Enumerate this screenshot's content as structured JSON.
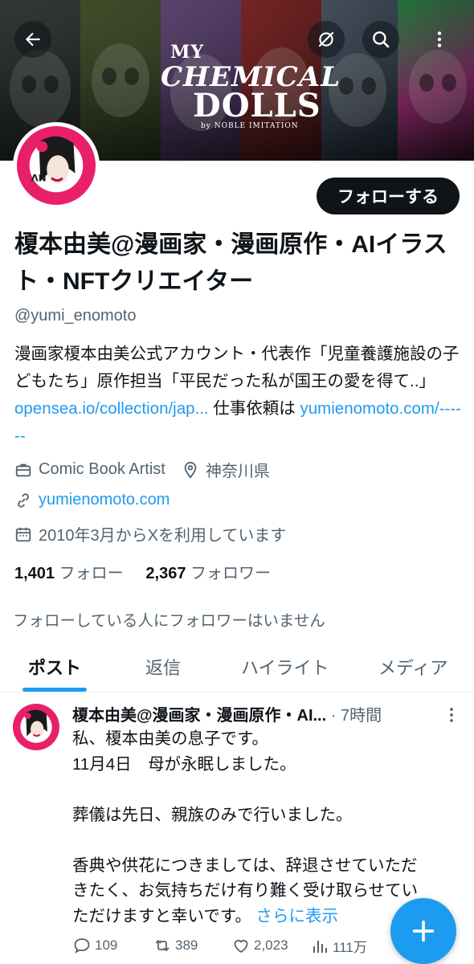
{
  "banner": {
    "logo_my": "MY",
    "logo_chemical": "CHEMICAL",
    "logo_dolls": "DOLLS",
    "logo_subtitle": "by NOBLE IMITATION",
    "colors": [
      "#2f3a36",
      "#3b4a2a",
      "#5a3b6a",
      "#7a2a2a",
      "#3a4a5a",
      "#2a6a3a"
    ]
  },
  "header": {
    "back_icon": "arrow-left-icon",
    "mute_icon": "bell-slash-icon",
    "search_icon": "search-icon",
    "more_icon": "more-vertical-icon"
  },
  "profile": {
    "follow_button": "フォローする",
    "name": "榎本由美@漫画家・漫画原作・AIイラスト・NFTクリエイター",
    "handle": "@yumi_enomoto",
    "bio_text": "漫画家榎本由美公式アカウント・代表作「児童養護施設の子どもたち」原作担当「平民だった私が国王の愛を得て..」",
    "bio_link1": "opensea.io/collection/jap...",
    "bio_mid": " 仕事依頼は ",
    "bio_link2": "yumienomoto.com/------",
    "category": "Comic Book Artist",
    "location": "神奈川県",
    "website": "yumienomoto.com",
    "joined": "2010年3月からXを利用しています",
    "following_count": "1,401",
    "following_label": "フォロー",
    "followers_count": "2,367",
    "followers_label": "フォロワー",
    "no_mutuals": "フォローしている人にフォロワーはいません"
  },
  "tabs": [
    {
      "label": "ポスト",
      "active": true
    },
    {
      "label": "返信",
      "active": false
    },
    {
      "label": "ハイライト",
      "active": false
    },
    {
      "label": "メディア",
      "active": false
    }
  ],
  "post": {
    "author": "榎本由美@漫画家・漫画原作・AI...",
    "time": " · 7時間",
    "lines": [
      "私、榎本由美の息子です。",
      "11月4日　母が永眠しました。",
      "",
      "葬儀は先日、親族のみで行いました。",
      "",
      "香典や供花につきましては、辞退させていただ",
      "きたく、お気持ちだけ有り難く受け取らせてい",
      "ただけますと幸いです。"
    ],
    "show_more": "さらに表示",
    "replies": "109",
    "reposts": "389",
    "likes": "2,023",
    "views": "111万"
  },
  "fab": {
    "icon": "plus-icon"
  }
}
